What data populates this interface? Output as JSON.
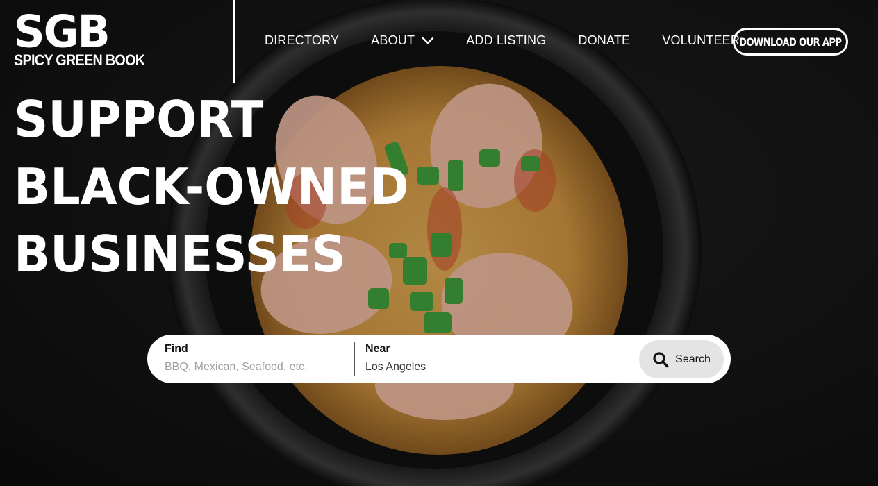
{
  "brand": {
    "mark": "SGB",
    "name": "SPICY GREEN BOOK"
  },
  "nav": {
    "items": [
      {
        "label": "DIRECTORY"
      },
      {
        "label": "ABOUT",
        "has_dropdown": true
      },
      {
        "label": "ADD LISTING"
      },
      {
        "label": "DONATE"
      },
      {
        "label": "VOLUNTEER"
      }
    ],
    "app_button": "DOWNLOAD OUR APP"
  },
  "hero": {
    "headline_lines": [
      "SUPPORT",
      "BLACK-OWNED",
      "BUSINESSES"
    ]
  },
  "search": {
    "find_label": "Find",
    "find_placeholder": "BBQ, Mexican, Seafood, etc.",
    "near_label": "Near",
    "near_value": "Los Angeles",
    "button_label": "Search",
    "button_icon": "search-icon"
  },
  "colors": {
    "background": "#151515",
    "text": "#ffffff",
    "search_bar": "#ffffff",
    "search_button": "#e4e4e4"
  }
}
